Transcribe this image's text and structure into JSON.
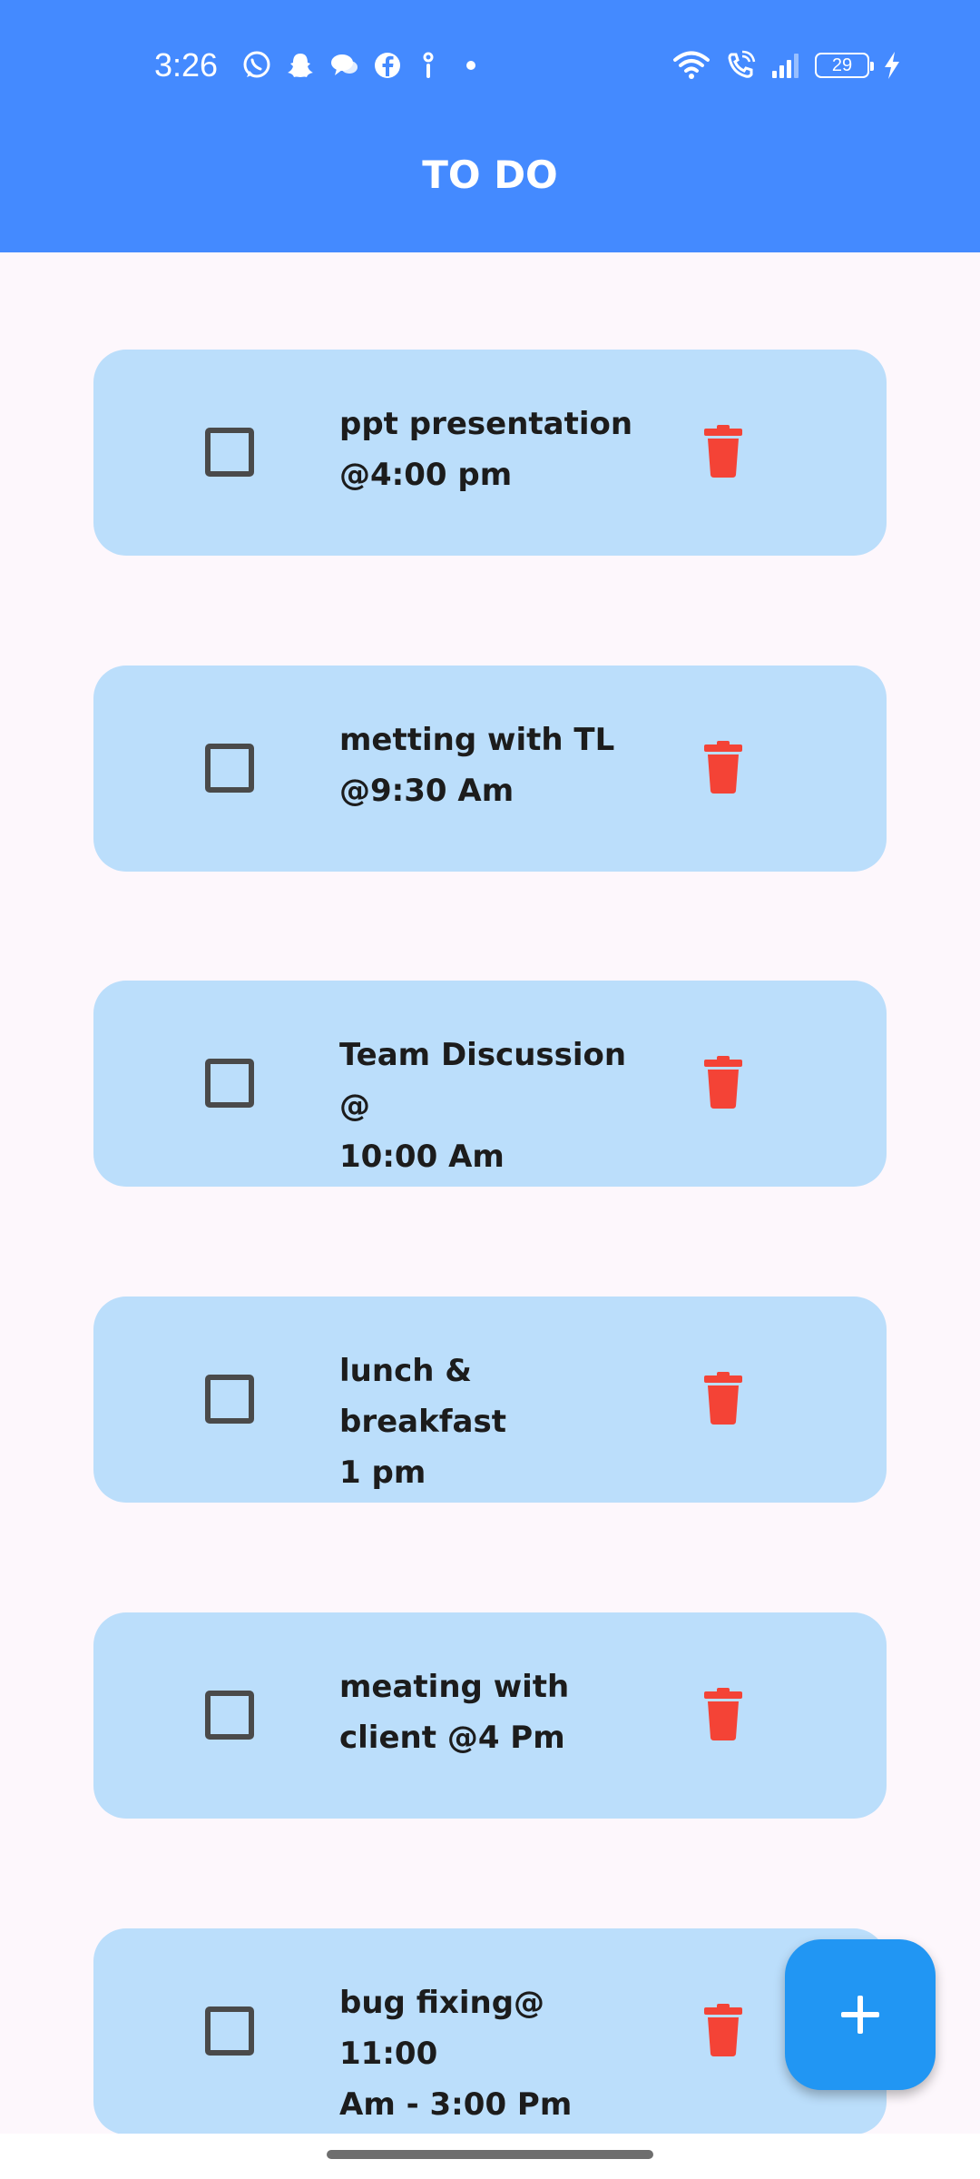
{
  "status_bar": {
    "time": "3:26",
    "battery": "29",
    "left_icons": [
      "whatsapp-icon",
      "snapchat-icon",
      "chat-bubbles-icon",
      "facebook-icon",
      "info-icon",
      "dot-icon"
    ],
    "right_icons": [
      "wifi-icon",
      "wifi-call-icon",
      "signal-icon",
      "battery-icon",
      "charging-icon"
    ]
  },
  "app_bar": {
    "title": "TO DO",
    "color": "#448aff"
  },
  "tasks": [
    {
      "text": "ppt presentation\n@4:00 pm",
      "checked": false
    },
    {
      "text": "metting with TL\n@9:30 Am",
      "checked": false
    },
    {
      "text": "Team Discussion @\n10:00 Am",
      "checked": false
    },
    {
      "text": "lunch & breakfast\n1 pm",
      "checked": false
    },
    {
      "text": "meating with\nclient @4 Pm",
      "checked": false
    },
    {
      "text": "bug fixing@ 11:00\nAm - 3:00 Pm",
      "checked": false
    }
  ],
  "colors": {
    "card_background": "#bbdefb",
    "delete_icon": "#f44336",
    "fab": "#2196f3",
    "page_background": "#fdf7fc"
  },
  "fab": {
    "icon": "plus-icon"
  }
}
